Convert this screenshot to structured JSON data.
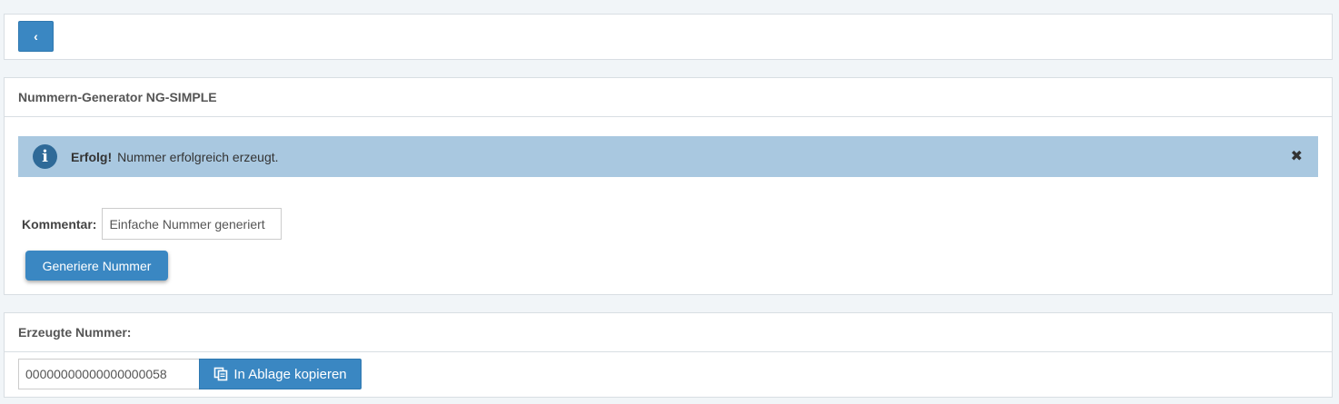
{
  "nav": {
    "back_symbol": "‹"
  },
  "generator": {
    "title": "Nummern-Generator NG-SIMPLE",
    "alert": {
      "icon": "info-icon",
      "title": "Erfolg!",
      "message": "Nummer erfolgreich erzeugt.",
      "close_symbol": "✖"
    },
    "comment_label": "Kommentar:",
    "comment_value": "Einfache Nummer generiert",
    "generate_label": "Generiere Nummer"
  },
  "output": {
    "title": "Erzeugte Nummer:",
    "number": "00000000000000000058",
    "copy_label": "In Ablage kopieren",
    "copy_icon": "copy-icon"
  },
  "colors": {
    "primary": "#3a87c2",
    "alert_bg": "#a9c8e0",
    "page_bg": "#f1f5f8"
  }
}
